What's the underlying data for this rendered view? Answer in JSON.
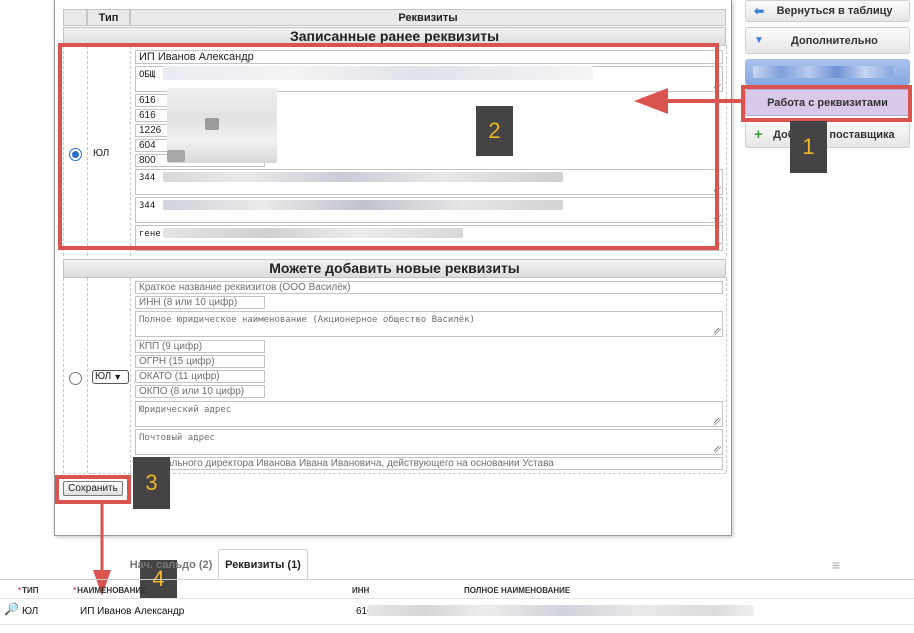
{
  "modal": {
    "header": {
      "type_col": "Тип",
      "req_col": "Реквизиты"
    },
    "saved_section_title": "Записанные ранее реквизиты",
    "saved": {
      "type_label": "ЮЛ",
      "name_value": "ИП Иванов Александр",
      "rows": [
        "ОБЩ",
        "616",
        "616",
        "1226",
        "604",
        "800",
        "344",
        "344",
        "гене"
      ]
    },
    "new_section_title": "Можете добавить новые реквизиты",
    "new": {
      "type_select": "ЮЛ",
      "placeholders": {
        "short_name": "Краткое название реквизитов (ООО Василёк)",
        "inn": "ИНН (8 или 10 цифр)",
        "full_name": "Полное юридическое наименование (Акционерное общество Василёк)",
        "kpp": "КПП (9 цифр)",
        "ogrn": "ОГРН (15 цифр)",
        "okato": "ОКАТО (11 цифр)",
        "okpo": "ОКПО (8 или 10 цифр)",
        "legal_address": "Юридический адрес",
        "postal_address": "Почтовый адрес",
        "director": "Генерального директора Иванова Ивана Ивановича, действующего на основании Устава"
      }
    },
    "save_label": "Сохранить"
  },
  "right_panel": {
    "back_label": "Вернуться в таблицу",
    "more_label": "Дополнительно",
    "requisites_label": "Работа с реквизитами",
    "add_supplier_label": "Добавить поставщика"
  },
  "annotations": {
    "n1": "1",
    "n2": "2",
    "n3": "3",
    "n4": "4"
  },
  "bottom": {
    "tabs": [
      "Нач. сальдо (2)",
      "Реквизиты (1)"
    ],
    "columns": {
      "type": "ТИП",
      "name": "НАИМЕНОВАНИЕ",
      "inn": "ИНН",
      "full_name": "ПОЛНОЕ НАИМЕНОВАНИЕ"
    },
    "row": {
      "type": "ЮЛ",
      "name": "ИП Иванов Александр",
      "inn": "616"
    }
  },
  "colors": {
    "annotation_red": "#d9544f",
    "tag_text": "#f0b429",
    "accent_blue": "#2a6fcf",
    "requisites_button_bg": "#d8c9ea"
  }
}
